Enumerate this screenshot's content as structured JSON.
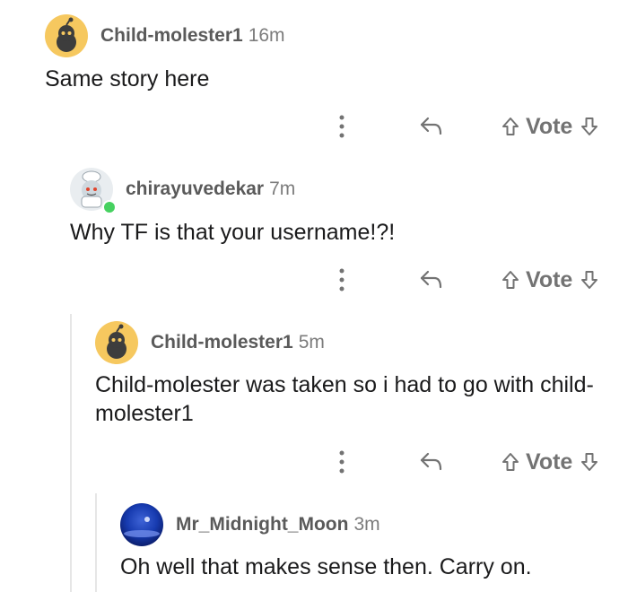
{
  "comments": [
    {
      "username": "Child-molester1",
      "time": "16m",
      "body": "Same story here",
      "avatar": "yellow-snoo-avatar",
      "vote_label": "Vote"
    },
    {
      "username": "chirayuvedekar",
      "time": "7m",
      "body": "Why TF is that your username!?!",
      "avatar": "chef-snoo-avatar",
      "online": true,
      "vote_label": "Vote"
    },
    {
      "username": "Child-molester1",
      "time": "5m",
      "body": "Child-molester was taken so i had to go with child-molester1",
      "avatar": "yellow-snoo-avatar",
      "vote_label": "Vote"
    },
    {
      "username": "Mr_Midnight_Moon",
      "time": "3m",
      "body": "Oh well that makes sense then. Carry on.",
      "avatar": "moon-avatar"
    }
  ],
  "colors": {
    "thread_line": "#e6e6e6",
    "avatar_yellow": "#f6c85f",
    "online": "#46d160",
    "icon_gray": "#737373"
  }
}
